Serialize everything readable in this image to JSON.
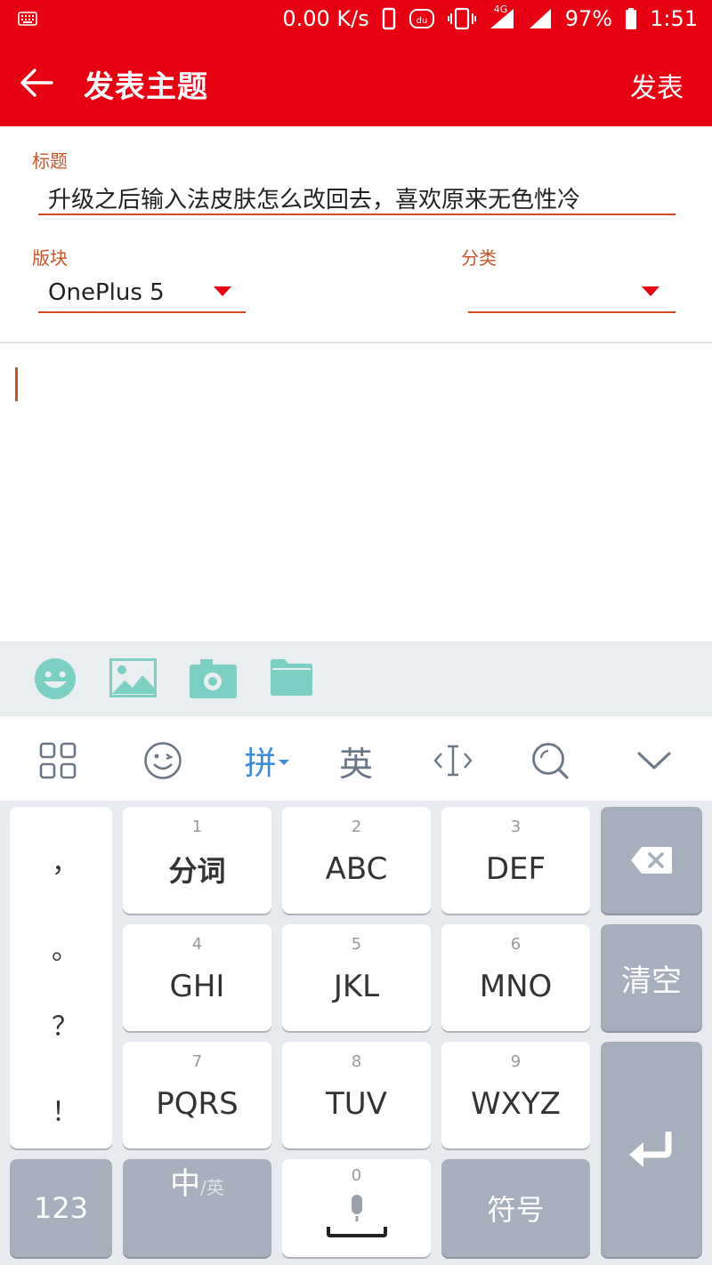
{
  "status_bar": {
    "speed": "0.00 K/s",
    "network": "4G",
    "battery": "97%",
    "time": "1:51",
    "icons": [
      "keyboard-icon",
      "phone-outline-icon",
      "du-icon",
      "vibrate-icon",
      "signal-icon",
      "signal-icon",
      "battery-icon"
    ]
  },
  "app_bar": {
    "title": "发表主题",
    "publish": "发表",
    "accent": "#e60012"
  },
  "form": {
    "title_label": "标题",
    "title_value": "升级之后输入法皮肤怎么改回去，喜欢原来无色性冷",
    "board_label": "版块",
    "board_value": "OnePlus 5",
    "category_label": "分类",
    "category_value": ""
  },
  "attachments": {
    "icons": [
      "emoji-icon",
      "image-icon",
      "camera-icon",
      "folder-icon"
    ],
    "color": "#7ccfc3"
  },
  "ime_toolbar": {
    "pinyin": "拼",
    "english": "英",
    "icons": [
      "grid-icon",
      "smiley-icon",
      "cursor-icon",
      "search-icon",
      "chevron-down-icon"
    ]
  },
  "keyboard": {
    "punctuation": [
      "，",
      "。",
      "？",
      "！"
    ],
    "keys": [
      {
        "num": "1",
        "label": "分词"
      },
      {
        "num": "2",
        "label": "ABC"
      },
      {
        "num": "3",
        "label": "DEF"
      },
      {
        "num": "4",
        "label": "GHI"
      },
      {
        "num": "5",
        "label": "JKL"
      },
      {
        "num": "6",
        "label": "MNO"
      },
      {
        "num": "7",
        "label": "PQRS"
      },
      {
        "num": "8",
        "label": "TUV"
      },
      {
        "num": "9",
        "label": "WXYZ"
      }
    ],
    "clear": "清空",
    "num_key": "123",
    "lang_main": "中",
    "lang_sub": "/英",
    "space_num": "0",
    "symbols": "符号"
  }
}
